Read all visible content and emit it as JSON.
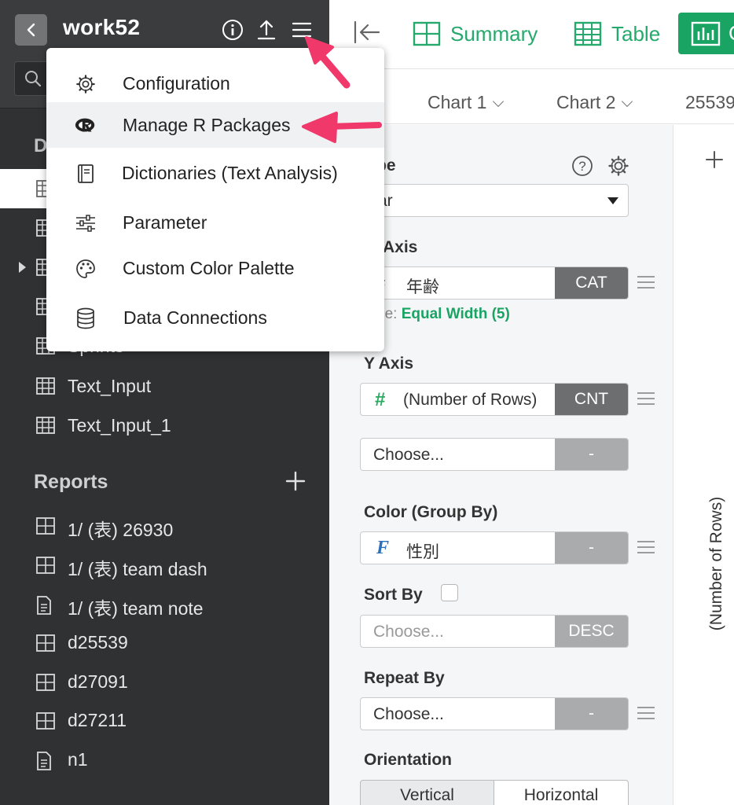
{
  "project": {
    "title": "work52"
  },
  "sidebar": {
    "section_partial": "D",
    "datasets": [
      {
        "label": "",
        "active": true
      },
      {
        "label": ""
      },
      {
        "label": "",
        "expandable": true
      },
      {
        "label": ""
      },
      {
        "label": "Sprints"
      },
      {
        "label": "Text_Input"
      },
      {
        "label": "Text_Input_1"
      }
    ],
    "reports": {
      "title": "Reports",
      "items": [
        {
          "label": "1/ (表) 26930",
          "type": "dashboard"
        },
        {
          "label": "1/ (表) team dash",
          "type": "dashboard"
        },
        {
          "label": "1/ (表) team note",
          "type": "note"
        },
        {
          "label": "d25539",
          "type": "dashboard"
        },
        {
          "label": "d27091",
          "type": "dashboard"
        },
        {
          "label": "d27211",
          "type": "dashboard"
        },
        {
          "label": "n1",
          "type": "note"
        }
      ]
    }
  },
  "menu": {
    "items": [
      {
        "label": "Configuration",
        "icon": "gear-icon"
      },
      {
        "label": "Manage R Packages",
        "icon": "r-logo-icon",
        "hovered": true
      },
      {
        "label": "Dictionaries (Text Analysis)",
        "icon": "book-icon"
      },
      {
        "label": "Parameter",
        "icon": "sliders-icon"
      },
      {
        "label": "Custom Color Palette",
        "icon": "palette-icon"
      },
      {
        "label": "Data Connections",
        "icon": "database-icon"
      }
    ]
  },
  "views": {
    "tabs": [
      {
        "label": "Summary",
        "icon": "summary-grid-icon"
      },
      {
        "label": "Table",
        "icon": "table-grid-icon"
      },
      {
        "label": "C",
        "icon": "chart-bars-icon",
        "active": true
      }
    ]
  },
  "charts": {
    "tabs": [
      "Chart 1",
      "Chart 2",
      "25539"
    ]
  },
  "config": {
    "type": {
      "title": "pe",
      "value": "ar"
    },
    "x_axis": {
      "title": "Axis",
      "field": "年齢",
      "button": "CAT",
      "subtype_prefix": "pe:",
      "subtype_value": "Equal Width (5)"
    },
    "y_axis": {
      "title": "Y Axis",
      "field": "(Number of Rows)",
      "button": "CNT"
    },
    "y_axis_2": {
      "placeholder": "Choose...",
      "button": "-"
    },
    "color": {
      "title": "Color (Group By)",
      "field": "性別",
      "button": "-"
    },
    "sort": {
      "title": "Sort By",
      "placeholder": "Choose...",
      "button": "DESC"
    },
    "repeat": {
      "title": "Repeat By",
      "placeholder": "Choose...",
      "button": "-"
    },
    "orientation": {
      "title": "Orientation",
      "options": [
        "Vertical",
        "Horizontal"
      ]
    }
  },
  "chart_area": {
    "y_label": "(Number of Rows)"
  },
  "colors": {
    "accent": "#1aa464",
    "sidebar": "#2f3133",
    "annotation_arrow": "#f0386b"
  }
}
